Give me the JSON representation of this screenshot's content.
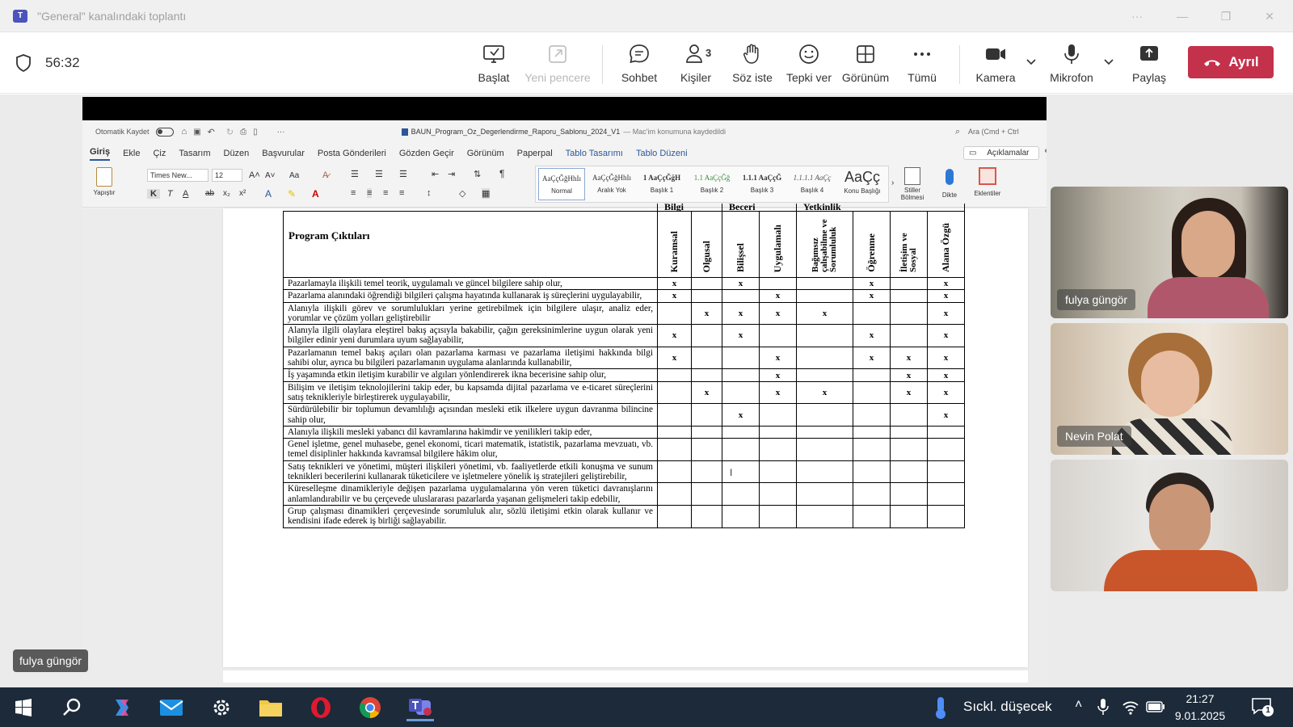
{
  "window": {
    "title": "\"General\" kanalındaki toplantı"
  },
  "meeting": {
    "timer": "56:32",
    "toolbar": {
      "start": "Başlat",
      "new_window": "Yeni pencere",
      "chat": "Sohbet",
      "people": "Kişiler",
      "people_count": "3",
      "raise_hand": "Söz iste",
      "react": "Tepki ver",
      "view": "Görünüm",
      "more": "Tümü",
      "camera": "Kamera",
      "mic": "Mikrofon",
      "share": "Paylaş",
      "leave": "Ayrıl"
    },
    "participants": [
      {
        "name": "fulya güngör"
      },
      {
        "name": "Nevin Polat"
      },
      {
        "name": ""
      }
    ],
    "self_label": "fulya güngör"
  },
  "word": {
    "autosave": "Otomatik Kaydet",
    "doc_title": "BAUN_Program_Oz_Degerlendirme_Raporu_Sablonu_2024_V1",
    "doc_status": "— Mac'im konumuna kaydedildi",
    "search": "Ara (Cmd + Ctrl",
    "tabs": [
      "Giriş",
      "Ekle",
      "Çiz",
      "Tasarım",
      "Düzen",
      "Başvurular",
      "Posta Gönderileri",
      "Gözden Geçir",
      "Görünüm",
      "Paperpal",
      "Tablo Tasarımı",
      "Tablo Düzeni"
    ],
    "comments": "Açıklamalar",
    "font_name": "Times New...",
    "font_size": "12",
    "paste": "Yapıştır",
    "styles": [
      {
        "sample": "AaÇçĞğHhIı",
        "label": "Normal"
      },
      {
        "sample": "AaÇçĞğHhIı",
        "label": "Aralık Yok"
      },
      {
        "sample": "1 AaÇçĞğH",
        "label": "Başlık 1"
      },
      {
        "sample": "1.1 AaÇçĞğ",
        "label": "Başlık 2"
      },
      {
        "sample": "1.1.1 AaÇçĞ",
        "label": "Başlık 3"
      },
      {
        "sample": "1.1.1.1 AaÇç",
        "label": "Başlık 4"
      },
      {
        "sample": "AaÇç",
        "label": "Konu Başlığı"
      }
    ],
    "styles_pane": "Stiller Bölmesi",
    "dictate": "Dikte",
    "addins": "Eklentiler"
  },
  "table": {
    "groups": [
      "Bilgi",
      "Beceri",
      "Yetkinlik"
    ],
    "title": "Program Çıktıları",
    "columns": [
      "Kuramsal",
      "Olgusal",
      "Bilişsel",
      "Uygulamalı",
      "Bağımsız çalışabilme ve Sorumluluk",
      "Öğrenme",
      "İletişim ve Sosyal",
      "Alana Özgü"
    ],
    "rows": [
      {
        "text": "Pazarlamayla ilişkili temel teorik, uygulamalı ve güncel bilgilere sahip olur,",
        "marks": [
          "x",
          "",
          "x",
          "",
          "",
          "x",
          "",
          "x"
        ]
      },
      {
        "text": "Pazarlama alanındaki öğrendiği bilgileri çalışma hayatında kullanarak iş süreçlerini uygulayabilir,",
        "marks": [
          "x",
          "",
          "",
          "x",
          "",
          "x",
          "",
          "x"
        ]
      },
      {
        "text": "Alanıyla ilişkili görev ve sorumlulukları yerine getirebilmek için bilgilere ulaşır, analiz eder, yorumlar ve çözüm yolları geliştirebilir",
        "marks": [
          "",
          "x",
          "x",
          "x",
          "x",
          "",
          "",
          "x"
        ]
      },
      {
        "text": "Alanıyla ilgili olaylara eleştirel bakış açısıyla bakabilir, çağın gereksinimlerine uygun olarak yeni bilgiler edinir yeni durumlara uyum sağlayabilir,",
        "marks": [
          "x",
          "",
          "x",
          "",
          "",
          "x",
          "",
          "x"
        ]
      },
      {
        "text": "Pazarlamanın temel bakış açıları olan pazarlama karması ve pazarlama iletişimi hakkında bilgi sahibi olur, ayrıca bu bilgileri pazarlamanın uygulama alanlarında kullanabilir,",
        "marks": [
          "x",
          "",
          "",
          "x",
          "",
          "x",
          "x",
          "x"
        ]
      },
      {
        "text": "İş yaşamında etkin iletişim kurabilir ve algıları yönlendirerek ikna becerisine sahip olur,",
        "marks": [
          "",
          "",
          "",
          "x",
          "",
          "",
          "x",
          "x"
        ]
      },
      {
        "text": "Bilişim ve iletişim teknolojilerini takip eder, bu kapsamda dijital pazarlama ve e-ticaret süreçlerini satış teknikleriyle birleştirerek uygulayabilir,",
        "marks": [
          "",
          "x",
          "",
          "x",
          "x",
          "",
          "x",
          "x"
        ]
      },
      {
        "text": "Sürdürülebilir bir toplumun devamlılığı açısından mesleki etik ilkelere uygun davranma bilincine sahip olur,",
        "marks": [
          "",
          "",
          "x",
          "",
          "",
          "",
          "",
          "x"
        ]
      },
      {
        "text": "Alanıyla ilişkili mesleki yabancı dil kavramlarına hakimdir ve yenilikleri takip eder,",
        "marks": [
          "",
          "",
          "",
          "",
          "",
          "",
          "",
          ""
        ]
      },
      {
        "text": "Genel işletme, genel muhasebe, genel ekonomi, ticari matematik, istatistik, pazarlama mevzuatı, vb. temel disiplinler hakkında kavramsal bilgilere hâkim olur,",
        "marks": [
          "",
          "",
          "",
          "",
          "",
          "",
          "",
          ""
        ]
      },
      {
        "text": "Satış teknikleri ve yönetimi, müşteri ilişkileri yönetimi, vb. faaliyetlerde etkili konuşma ve sunum teknikleri becerilerini kullanarak tüketicilere ve işletmelere yönelik iş stratejileri geliştirebilir,",
        "marks": [
          "",
          "",
          "",
          "",
          "",
          "",
          "",
          ""
        ]
      },
      {
        "text": "Küreselleşme dinamikleriyle değişen pazarlama uygulamalarına yön veren tüketici davranışlarını anlamlandırabilir ve bu çerçevede uluslararası pazarlarda yaşanan gelişmeleri takip edebilir,",
        "marks": [
          "",
          "",
          "",
          "",
          "",
          "",
          "",
          ""
        ]
      },
      {
        "text": "Grup çalışması dinamikleri çerçevesinde sorumluluk alır, sözlü iletişimi etkin olarak kullanır ve kendisini ifade ederek iş birliği sağlayabilir.",
        "marks": [
          "",
          "",
          "",
          "",
          "",
          "",
          "",
          ""
        ]
      }
    ]
  },
  "taskbar": {
    "weather": "Sıckl. düşecek",
    "time": "21:27",
    "date": "9.01.2025",
    "notifications": "1"
  },
  "colors": {
    "leave": "#c4314b",
    "teams": "#4b53bc",
    "taskbar": "#1c2a3a"
  }
}
